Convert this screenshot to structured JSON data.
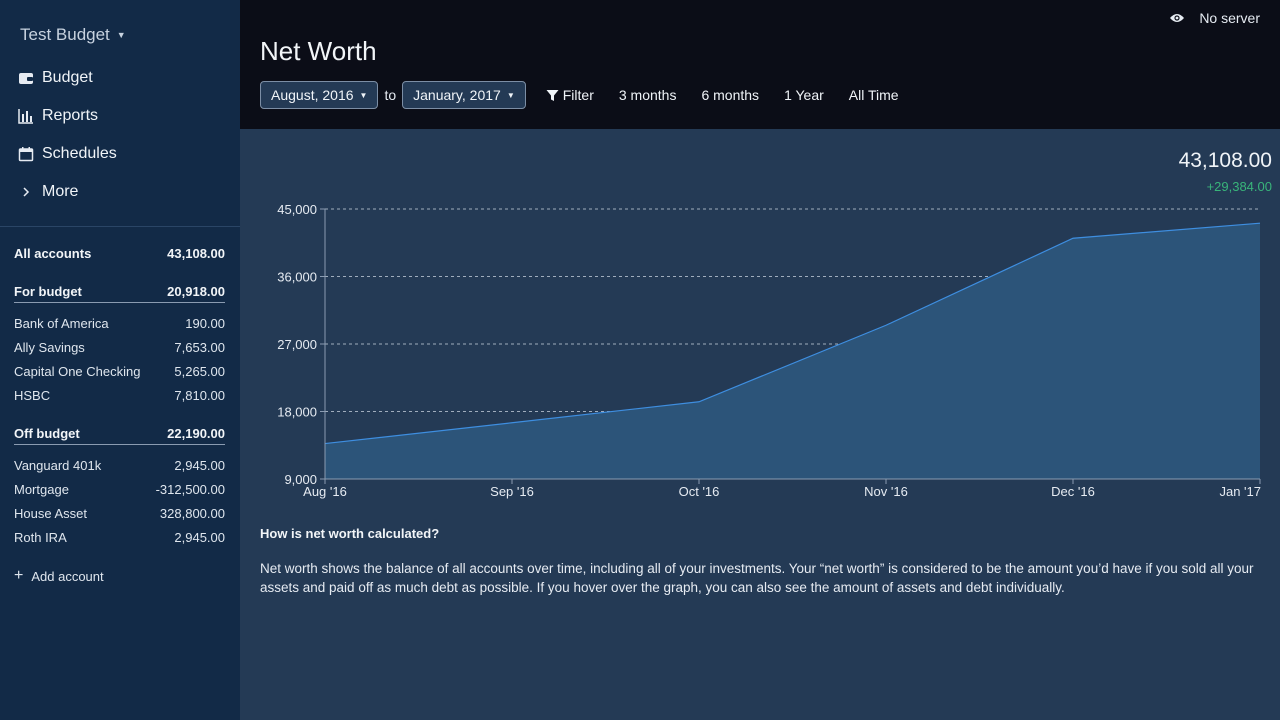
{
  "sidebar": {
    "budget_name": "Test Budget",
    "nav": [
      {
        "label": "Budget",
        "icon": "wallet-icon"
      },
      {
        "label": "Reports",
        "icon": "bar-chart-icon"
      },
      {
        "label": "Schedules",
        "icon": "calendar-icon"
      },
      {
        "label": "More",
        "icon": "chevron-right-icon"
      }
    ],
    "all_accounts": {
      "label": "All accounts",
      "value": "43,108.00"
    },
    "for_budget": {
      "label": "For budget",
      "value": "20,918.00"
    },
    "for_budget_accounts": [
      {
        "name": "Bank of America",
        "value": "190.00"
      },
      {
        "name": "Ally Savings",
        "value": "7,653.00"
      },
      {
        "name": "Capital One Checking",
        "value": "5,265.00"
      },
      {
        "name": "HSBC",
        "value": "7,810.00"
      }
    ],
    "off_budget": {
      "label": "Off budget",
      "value": "22,190.00"
    },
    "off_budget_accounts": [
      {
        "name": "Vanguard 401k",
        "value": "2,945.00"
      },
      {
        "name": "Mortgage",
        "value": "-312,500.00"
      },
      {
        "name": "House Asset",
        "value": "328,800.00"
      },
      {
        "name": "Roth IRA",
        "value": "2,945.00"
      }
    ],
    "add_account": "Add account"
  },
  "header": {
    "server_status": "No server",
    "title": "Net Worth",
    "start_month": "August, 2016",
    "to_label": "to",
    "end_month": "January, 2017",
    "filter_label": "Filter",
    "ranges": [
      "3 months",
      "6 months",
      "1 Year",
      "All Time"
    ]
  },
  "summary": {
    "total": "43,108.00",
    "change": "+29,384.00",
    "change_color": "#39b47a"
  },
  "chart_data": {
    "type": "area",
    "categories": [
      "Aug '16",
      "Sep '16",
      "Oct '16",
      "Nov '16",
      "Dec '16",
      "Jan '17"
    ],
    "values": [
      13724,
      16500,
      19300,
      29500,
      41100,
      43108
    ],
    "ylim": [
      9000,
      45000
    ],
    "yticks": [
      "9,000",
      "18,000",
      "27,000",
      "36,000",
      "45,000"
    ],
    "ytick_values": [
      9000,
      18000,
      27000,
      36000,
      45000
    ],
    "grid": true,
    "line_color": "#3e8ee0",
    "fill_color": "#2c5479"
  },
  "explanation": {
    "title": "How is net worth calculated?",
    "body": "Net worth shows the balance of all accounts over time, including all of your investments. Your “net worth” is considered to be the amount you’d have if you sold all your assets and paid off as much debt as possible. If you hover over the graph, you can also see the amount of assets and debt individually."
  }
}
